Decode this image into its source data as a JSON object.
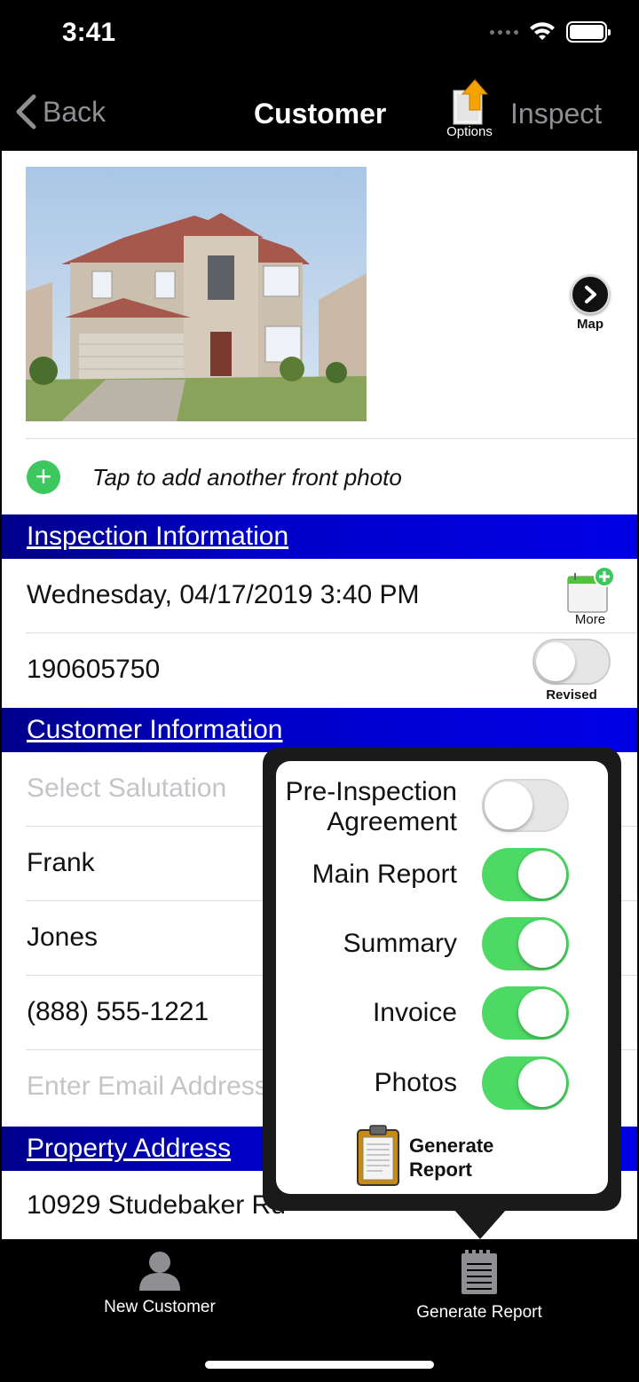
{
  "status_bar": {
    "time": "3:41"
  },
  "nav": {
    "back_label": "Back",
    "title": "Customer",
    "options_label": "Options",
    "inspect_label": "Inspect"
  },
  "photo": {
    "map_label": "Map",
    "add_photo_text": "Tap to add another front photo"
  },
  "inspection_info": {
    "header": "Inspection Information",
    "date": "Wednesday, 04/17/2019 3:40 PM",
    "more_label": "More",
    "report_number": "190605750",
    "revised_label": "Revised",
    "revised_on": false
  },
  "customer_info": {
    "header": "Customer Information",
    "salutation_placeholder": "Select Salutation",
    "first_name": "Frank",
    "last_name": "Jones",
    "phone": "(888) 555-1221",
    "email_placeholder": "Enter Email Address"
  },
  "property": {
    "header": "Property Address",
    "address": "10929 Studebaker Rd"
  },
  "report_popover": {
    "items": [
      {
        "label": "Pre-Inspection Agreement",
        "on": false
      },
      {
        "label": "Main Report",
        "on": true
      },
      {
        "label": "Summary",
        "on": true
      },
      {
        "label": "Invoice",
        "on": true
      },
      {
        "label": "Photos",
        "on": true
      }
    ],
    "generate_line1": "Generate",
    "generate_line2": "Report"
  },
  "tab_bar": {
    "tabs": [
      {
        "label": "New Customer",
        "icon": "person-icon"
      },
      {
        "label": "Generate Report",
        "icon": "report-notepad-icon"
      }
    ]
  },
  "colors": {
    "section_header_blue": "#0000c8",
    "toggle_on_green": "#4cd964",
    "add_green": "#3cc85e"
  }
}
